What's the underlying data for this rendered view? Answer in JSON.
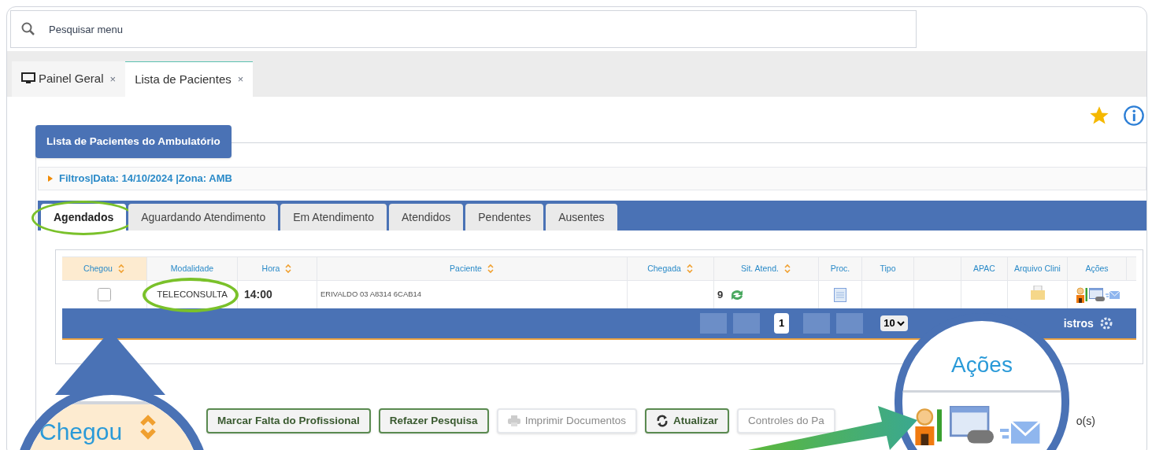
{
  "search": {
    "placeholder": "Pesquisar menu"
  },
  "tabs": [
    {
      "label": "Painel Geral",
      "close": "×",
      "selected": false,
      "kind": "monitor"
    },
    {
      "label": "Lista de Pacientes",
      "close": "×",
      "selected": true,
      "kind": "plain"
    }
  ],
  "panel": {
    "title": "Lista de Pacientes do Ambulatório",
    "filter": "Filtros|Data: 14/10/2024 |Zona: AMB"
  },
  "list_tabs": [
    {
      "label": "Agendados",
      "selected": true,
      "highlighted": true
    },
    {
      "label": "Aguardando Atendimento",
      "selected": false,
      "highlighted": false
    },
    {
      "label": "Em Atendimento",
      "selected": false,
      "highlighted": false
    },
    {
      "label": "Atendidos",
      "selected": false,
      "highlighted": false
    },
    {
      "label": "Pendentes",
      "selected": false,
      "highlighted": false
    },
    {
      "label": "Ausentes",
      "selected": false,
      "highlighted": false
    }
  ],
  "table": {
    "columns": [
      {
        "label": "Chegou",
        "sortable": true,
        "selected": true
      },
      {
        "label": "Modalidade",
        "sortable": false,
        "selected": false
      },
      {
        "label": "Hora",
        "sortable": true,
        "selected": false
      },
      {
        "label": "Paciente",
        "sortable": true,
        "selected": false
      },
      {
        "label": "Chegada",
        "sortable": true,
        "selected": false
      },
      {
        "label": "Sit. Atend.",
        "sortable": true,
        "selected": false
      },
      {
        "label": "Proc.",
        "sortable": false,
        "selected": false
      },
      {
        "label": "Tipo",
        "sortable": false,
        "selected": false
      },
      {
        "sortable": false,
        "selected": false
      },
      {
        "label": "APAC",
        "sortable": false,
        "selected": false
      },
      {
        "label": "Arquivo Clini",
        "sortable": false,
        "selected": false
      },
      {
        "label": "Ações",
        "sortable": false,
        "selected": false
      }
    ],
    "rows": [
      {
        "chegou": false,
        "modalidade": "TELECONSULTA",
        "modalidade_highlighted": true,
        "hora": "14:00",
        "paciente": "ERIVALDO 03 A8314 6CAB14",
        "sit_atend": "9"
      }
    ]
  },
  "pager": {
    "page": "1",
    "page_size": "10",
    "summary": "istros"
  },
  "buttons": [
    {
      "label": "Marcar Falta do Profissional",
      "disabled": false,
      "kind": "text"
    },
    {
      "label": "Refazer Pesquisa",
      "disabled": false,
      "kind": "text"
    },
    {
      "label": "Imprimir Documentos",
      "disabled": true,
      "kind": "print"
    },
    {
      "label": "Atualizar",
      "disabled": false,
      "kind": "refresh"
    },
    {
      "label": "Controles do Pa",
      "disabled": true,
      "kind": "text"
    }
  ],
  "trailing_text": "o(s)",
  "zoom_left": {
    "label": "Chegou"
  },
  "zoom_right": {
    "label": "Ações"
  }
}
